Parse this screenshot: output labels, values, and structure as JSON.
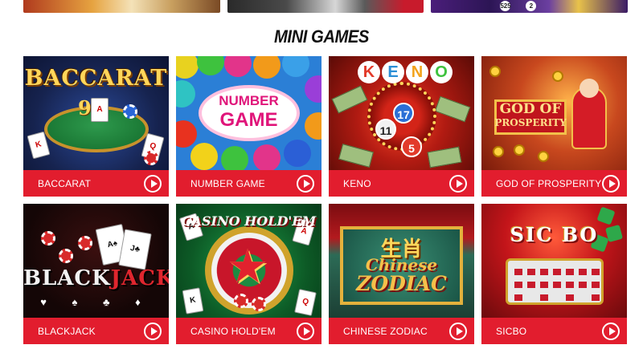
{
  "top_banners": {
    "lottery_balls": [
      "525",
      "2",
      "525"
    ]
  },
  "section": {
    "title": "MINI GAMES"
  },
  "games": [
    {
      "label": "BACCARAT",
      "art_title": "BACCARAT",
      "art_number": "9"
    },
    {
      "label": "NUMBER GAME",
      "art_title_line1": "NUMBER",
      "art_title_line2": "GAME"
    },
    {
      "label": "KENO",
      "art_letters": [
        "K",
        "E",
        "N",
        "O"
      ],
      "art_balls": [
        "17",
        "11",
        "5"
      ]
    },
    {
      "label": "GOD OF PROSPERITY",
      "art_title_line1": "GOD OF",
      "art_title_line2": "PROSPERITY"
    },
    {
      "label": "BLACKJACK",
      "art_title_part1": "BLACK",
      "art_title_part2": "JACK",
      "art_suits": "♥ ♠ ♣ ♦"
    },
    {
      "label": "CASINO HOLD'EM",
      "art_title": "CASINO HOLD'EM"
    },
    {
      "label": "CHINESE ZODIAC",
      "art_cn": "生肖",
      "art_title_line1": "Chinese",
      "art_title_line2": "ZODIAC"
    },
    {
      "label": "SICBO",
      "art_title": "SIC BO"
    }
  ],
  "colors": {
    "accent": "#e21d2e",
    "label_text": "#ffffff",
    "title_text": "#111111"
  },
  "icons": {
    "play": "play-circle-icon"
  }
}
